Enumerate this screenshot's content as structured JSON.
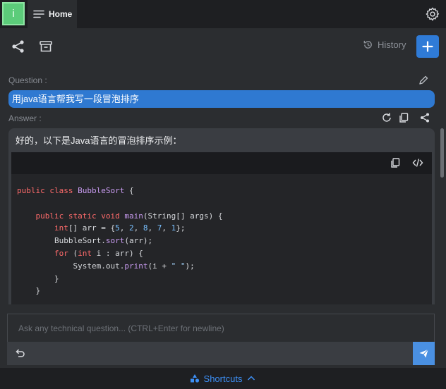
{
  "app": {
    "logo_letter": "i"
  },
  "tabs": [
    {
      "label": "Home"
    }
  ],
  "toolbar": {
    "history_label": "History"
  },
  "question": {
    "section_label": "Question :",
    "text": "用java语言帮我写一段冒泡排序"
  },
  "answer": {
    "section_label": "Answer :",
    "intro": "好的，以下是Java语言的冒泡排序示例：",
    "code": "public class BubbleSort {\n\n    public static void main(String[] args) {\n        int[] arr = {5, 2, 8, 7, 1};\n        BubbleSort.sort(arr);\n        for (int i : arr) {\n            System.out.print(i + \" \");\n        }\n    }"
  },
  "input": {
    "placeholder": "Ask any technical question... (CTRL+Enter for newline)",
    "value": ""
  },
  "footer": {
    "shortcuts_label": "Shortcuts"
  },
  "colors": {
    "accent": "#2f7bd7",
    "logo": "#5ccc7a",
    "link": "#3d8ff5"
  }
}
